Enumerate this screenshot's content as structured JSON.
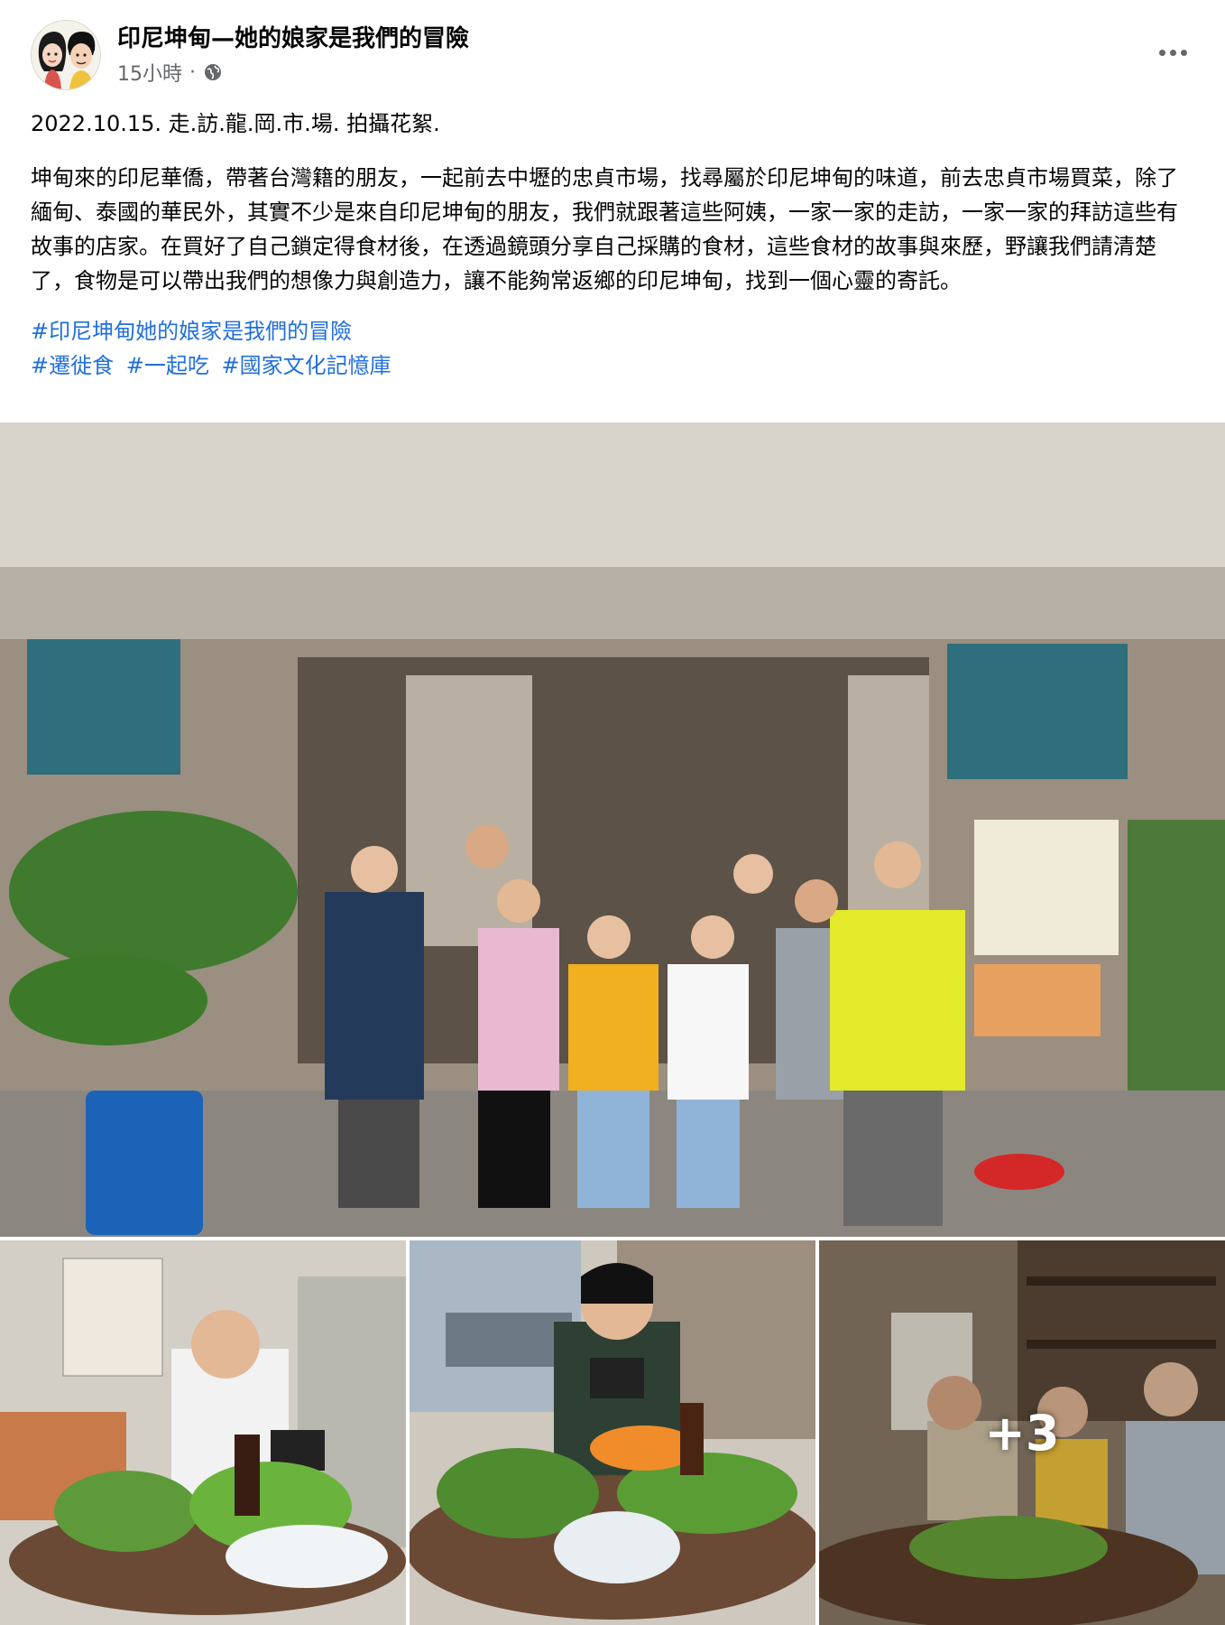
{
  "post": {
    "page_name": "印尼坤甸—她的娘家是我們的冒險",
    "timestamp": "15小時",
    "dot": "·",
    "audience_icon": "globe-icon",
    "date_line": "2022.10.15.  走.訪.龍.岡.市.場. 拍攝花絮.",
    "body": "坤甸來的印尼華僑，帶著台灣籍的朋友，一起前去中壢的忠貞市場，找尋屬於印尼坤甸的味道，前去忠貞市場買菜，除了緬甸、泰國的華民外，其實不少是來自印尼坤甸的朋友，我們就跟著這些阿姨，一家一家的走訪，一家一家的拜訪這些有故事的店家。在買好了自己鎖定得食材後，在透過鏡頭分享自己採購的食材，這些食材的故事與來歷，野讓我們請清楚了，食物是可以帶出我們的想像力與創造力，讓不能夠常返鄉的印尼坤甸，找到一個心靈的寄託。",
    "hashtags_line1": [
      "#印尼坤甸她的娘家是我們的冒險"
    ],
    "hashtags_line2": [
      "#遷徙食",
      "#一起吃",
      "#國家文化記憶庫"
    ],
    "more_photos": "+3"
  },
  "colors": {
    "link": "#216fdb",
    "secondary_text": "#65676b"
  }
}
